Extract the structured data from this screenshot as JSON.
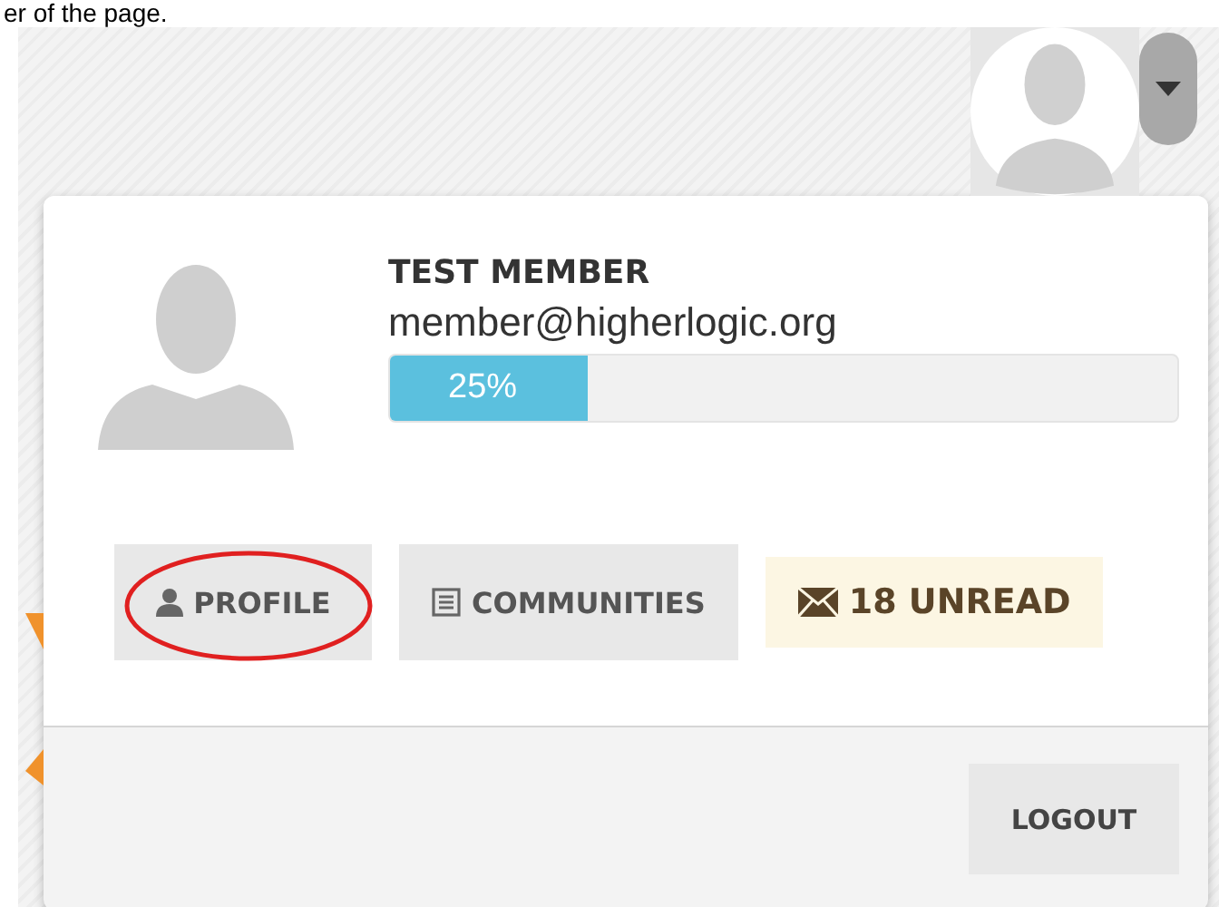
{
  "caption": "er of the page.",
  "member": {
    "name": "TEST MEMBER",
    "email": "member@higherlogic.org",
    "progress": {
      "level": 0.25,
      "reading": "25%"
    }
  },
  "actions": [
    {
      "kind": "profile",
      "label": "PROFILE",
      "highlighted": true
    },
    {
      "kind": "communities",
      "label": "COMMUNITIES",
      "highlighted": false
    },
    {
      "kind": "unread",
      "label": "18 UNREAD",
      "highlighted": false
    }
  ],
  "footer": {
    "logout": "LOGOUT"
  }
}
